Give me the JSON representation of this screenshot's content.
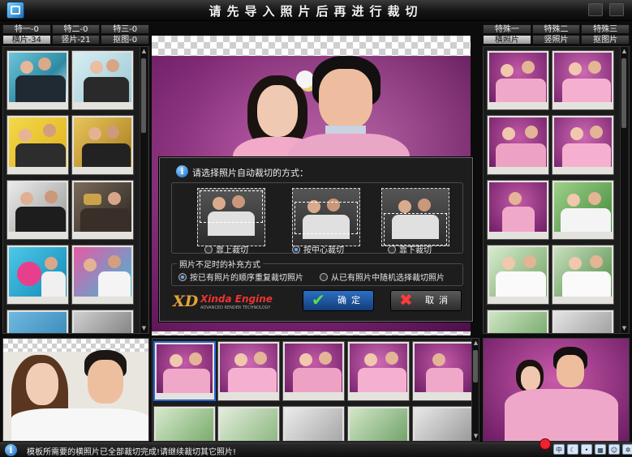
{
  "window": {
    "title": "请先导入照片后再进行裁切"
  },
  "left_tabs": {
    "row1": [
      "特一-0",
      "特二-0",
      "特三-0"
    ],
    "row2": [
      "横片-34",
      "竖片-21",
      "抠图-0"
    ],
    "active": "横片-34"
  },
  "right_tabs": {
    "row1": [
      "特殊一",
      "特殊二",
      "特殊三"
    ],
    "row2": [
      "横照片",
      "竖照片",
      "抠图片"
    ],
    "active": "横照片"
  },
  "dialog": {
    "prompt": "请选择照片自动裁切的方式：",
    "crop_options": [
      {
        "label": "靠上裁切",
        "selected": false
      },
      {
        "label": "按中心裁切",
        "selected": true
      },
      {
        "label": "靠下裁切",
        "selected": false
      }
    ],
    "fill_group_title": "照片不足时的补充方式",
    "fill_options": [
      {
        "label": "按已有照片的顺序重复裁切照片",
        "selected": true
      },
      {
        "label": "从已有照片中随机选择裁切照片",
        "selected": false
      }
    ],
    "brand": {
      "logo": "XD",
      "name": "Xinda Engine",
      "tagline": "ADVANCED RENDER TECHNOLOGY"
    },
    "ok_label": "确定",
    "cancel_label": "取消"
  },
  "status": {
    "message": "模板所需要的横照片已全部裁切完成!请继续裁切其它照片!"
  },
  "tray": {
    "ime_label": "中"
  },
  "colors": {
    "accent": "#2c6fc2",
    "backdrop": "#8a2f80",
    "panel": "#1b1b1b"
  }
}
